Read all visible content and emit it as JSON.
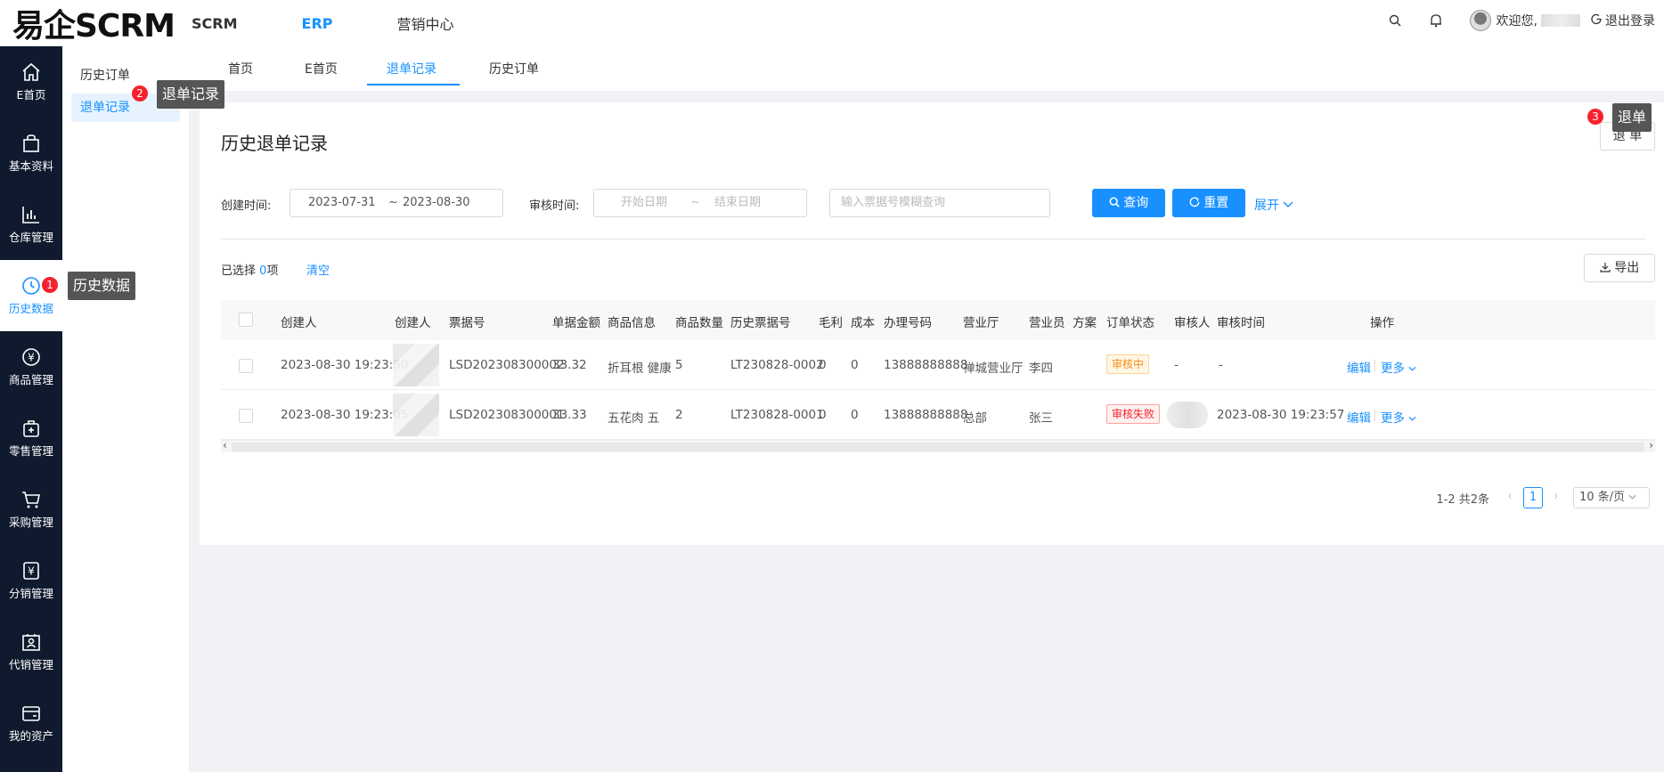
{
  "header": {
    "logo": "易企SCRM",
    "nav": [
      "SCRM",
      "ERP",
      "营销中心"
    ],
    "welcome": "欢迎您,",
    "logout": "退出登录"
  },
  "sidebar": {
    "items": [
      {
        "label": "E首页",
        "icon": "home-icon"
      },
      {
        "label": "基本资料",
        "icon": "bag-icon"
      },
      {
        "label": "仓库管理",
        "icon": "bar-chart-icon"
      },
      {
        "label": "历史数据",
        "icon": "clock-icon"
      },
      {
        "label": "商品管理",
        "icon": "yen-circle-icon"
      },
      {
        "label": "零售管理",
        "icon": "store-icon"
      },
      {
        "label": "采购管理",
        "icon": "cart-icon"
      },
      {
        "label": "分销管理",
        "icon": "yen-box-icon"
      },
      {
        "label": "代销管理",
        "icon": "person-board-icon"
      },
      {
        "label": "我的资产",
        "icon": "wallet-icon"
      }
    ]
  },
  "subnav": {
    "items": [
      "历史订单",
      "退单记录"
    ]
  },
  "tabs": [
    "首页",
    "E首页",
    "退单记录",
    "历史订单"
  ],
  "page": {
    "title": "历史退单记录",
    "refund_button": "退 单",
    "filters": {
      "created_label": "创建时间:",
      "created_start": "2023-07-31",
      "range_sep": "~",
      "created_end": "2023-08-30",
      "audit_label": "审核时间:",
      "audit_start_ph": "开始日期",
      "audit_end_ph": "结束日期",
      "search_ph": "输入票据号模糊查询",
      "query_btn": "查询",
      "reset_btn": "重置",
      "expand": "展开"
    },
    "selection": {
      "prefix": "已选择",
      "count": "0",
      "suffix": "项",
      "clear": "清空"
    },
    "export": "导出"
  },
  "table": {
    "columns": [
      "创建人",
      "创建人",
      "票据号",
      "单据金额",
      "商品信息",
      "商品数量",
      "历史票据号",
      "毛利",
      "成本",
      "办理号码",
      "营业厅",
      "营业员",
      "方案",
      "订单状态",
      "审核人",
      "审核时间",
      "操作"
    ],
    "rows": [
      {
        "created": "2023-08-30 19:23:50",
        "ticket": "LSD202308300002",
        "amount": "33.32",
        "goods": "折耳根 健康",
        "qty": "5",
        "history_ticket": "LT230828-0002",
        "profit": "0",
        "cost": "0",
        "phone": "13888888888",
        "hall": "禅城营业厅",
        "clerk": "李四",
        "plan": "",
        "status": "审核中",
        "status_type": "pending",
        "auditor": "-",
        "audit_time": "-",
        "edit": "编辑",
        "more": "更多"
      },
      {
        "created": "2023-08-30 19:23:05",
        "ticket": "LSD202308300001",
        "amount": "33.33",
        "goods": "五花肉 五",
        "qty": "2",
        "history_ticket": "LT230828-0001",
        "profit": "0",
        "cost": "0",
        "phone": "13888888888",
        "hall": "总部",
        "clerk": "张三",
        "plan": "",
        "status": "审核失败",
        "status_type": "fail",
        "auditor": "",
        "audit_time": "2023-08-30 19:23:57",
        "edit": "编辑",
        "more": "更多"
      }
    ]
  },
  "pagination": {
    "summary": "1-2 共2条",
    "current": "1",
    "page_size": "10 条/页"
  },
  "tooltips": [
    {
      "num": "1",
      "text": "历史数据"
    },
    {
      "num": "2",
      "text": "退单记录"
    },
    {
      "num": "3",
      "text": "退单"
    }
  ],
  "colors": {
    "primary": "#1890ff",
    "sidebar": "#0f1a2e",
    "danger": "#f5222d",
    "warning": "#fa8c16"
  }
}
